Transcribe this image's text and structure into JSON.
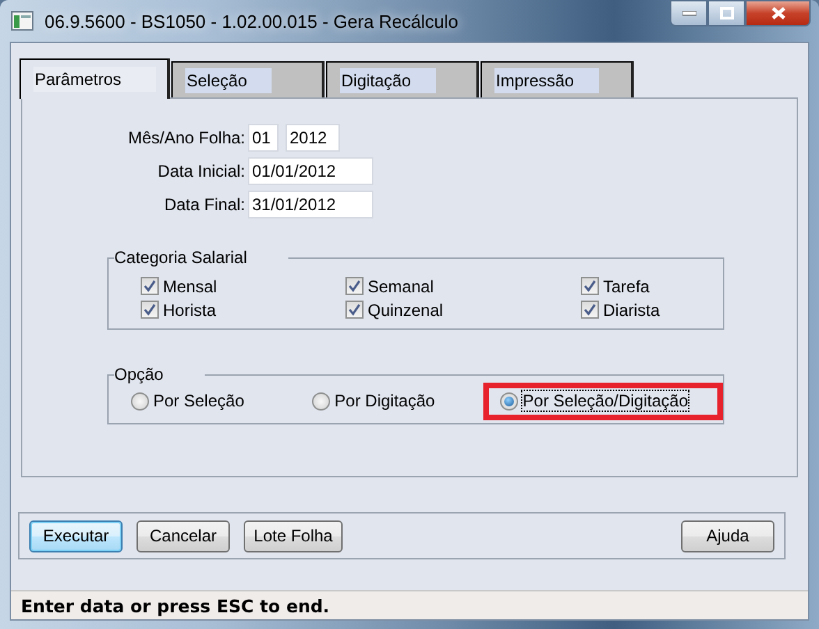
{
  "window": {
    "title": "06.9.5600 - BS1050 - 1.02.00.015 - Gera Recálculo"
  },
  "tabs": [
    {
      "label": "Parâmetros",
      "selected": true
    },
    {
      "label": "Seleção",
      "selected": false
    },
    {
      "label": "Digitação",
      "selected": false
    },
    {
      "label": "Impressão",
      "selected": false
    }
  ],
  "fields": [
    {
      "label": "Mês/Ano Folha:",
      "values": [
        "01",
        "2012"
      ]
    },
    {
      "label": "Data Inicial:",
      "values": [
        "01/01/2012"
      ]
    },
    {
      "label": "Data Final:",
      "values": [
        "31/01/2012"
      ]
    }
  ],
  "categoria_salarial": {
    "title": "Categoria Salarial",
    "items": [
      {
        "label": "Mensal",
        "checked": true
      },
      {
        "label": "Semanal",
        "checked": true
      },
      {
        "label": "Tarefa",
        "checked": true
      },
      {
        "label": "Horista",
        "checked": true
      },
      {
        "label": "Quinzenal",
        "checked": true
      },
      {
        "label": "Diarista",
        "checked": true
      }
    ]
  },
  "opcao": {
    "title": "Opção",
    "options": [
      {
        "label": "Por Seleção",
        "selected": false,
        "highlighted": false
      },
      {
        "label": "Por Digitação",
        "selected": false,
        "highlighted": false
      },
      {
        "label": "Por Seleção/Digitação",
        "selected": true,
        "highlighted": true
      }
    ]
  },
  "buttons": [
    {
      "label": "Executar",
      "default": true
    },
    {
      "label": "Cancelar",
      "default": false
    },
    {
      "label": "Lote Folha",
      "default": false
    },
    {
      "label": "Ajuda",
      "default": false
    }
  ],
  "status_bar": "Enter data or press ESC to end."
}
